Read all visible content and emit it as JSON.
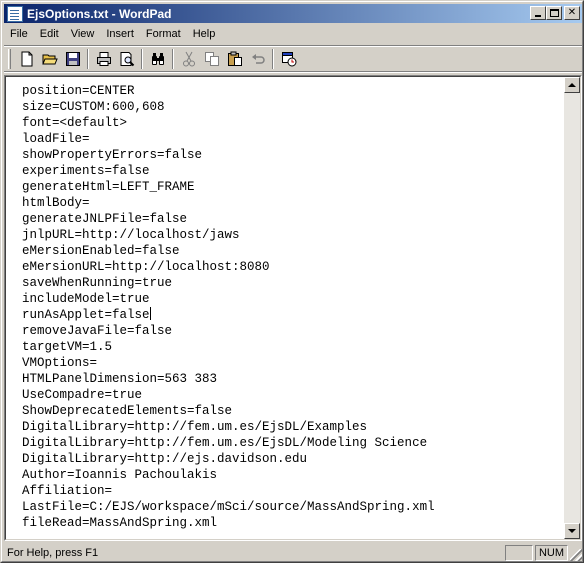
{
  "window": {
    "title": "EjsOptions.txt - WordPad",
    "minimize_label": "",
    "maximize_label": "",
    "close_label": "✕"
  },
  "menu": {
    "items": [
      {
        "label": "File"
      },
      {
        "label": "Edit"
      },
      {
        "label": "View"
      },
      {
        "label": "Insert"
      },
      {
        "label": "Format"
      },
      {
        "label": "Help"
      }
    ]
  },
  "toolbar": {
    "buttons": [
      {
        "icon": "new-document-icon"
      },
      {
        "icon": "open-folder-icon"
      },
      {
        "icon": "save-disk-icon"
      },
      {
        "icon": "print-icon"
      },
      {
        "icon": "print-preview-icon"
      },
      {
        "icon": "find-binoculars-icon"
      },
      {
        "icon": "cut-scissors-icon"
      },
      {
        "icon": "copy-icon"
      },
      {
        "icon": "paste-icon"
      },
      {
        "icon": "undo-icon"
      },
      {
        "icon": "insert-datetime-icon"
      }
    ]
  },
  "document": {
    "lines": [
      "position=CENTER",
      "size=CUSTOM:600,608",
      "font=<default>",
      "loadFile=",
      "showPropertyErrors=false",
      "experiments=false",
      "generateHtml=LEFT_FRAME",
      "htmlBody=",
      "generateJNLPFile=false",
      "jnlpURL=http://localhost/jaws",
      "eMersionEnabled=false",
      "eMersionURL=http://localhost:8080",
      "saveWhenRunning=true",
      "includeModel=true",
      "runAsApplet=false",
      "removeJavaFile=false",
      "targetVM=1.5",
      "VMOptions=",
      "HTMLPanelDimension=563 383",
      "UseCompadre=true",
      "ShowDeprecatedElements=false",
      "DigitalLibrary=http://fem.um.es/EjsDL/Examples",
      "DigitalLibrary=http://fem.um.es/EjsDL/Modeling Science",
      "DigitalLibrary=http://ejs.davidson.edu",
      "Author=Ioannis Pachoulakis",
      "Affiliation=",
      "LastFile=C:/EJS/workspace/mSci/source/MassAndSpring.xml",
      "fileRead=MassAndSpring.xml"
    ]
  },
  "status": {
    "help_text": "For Help, press F1",
    "num_indicator": "NUM"
  }
}
